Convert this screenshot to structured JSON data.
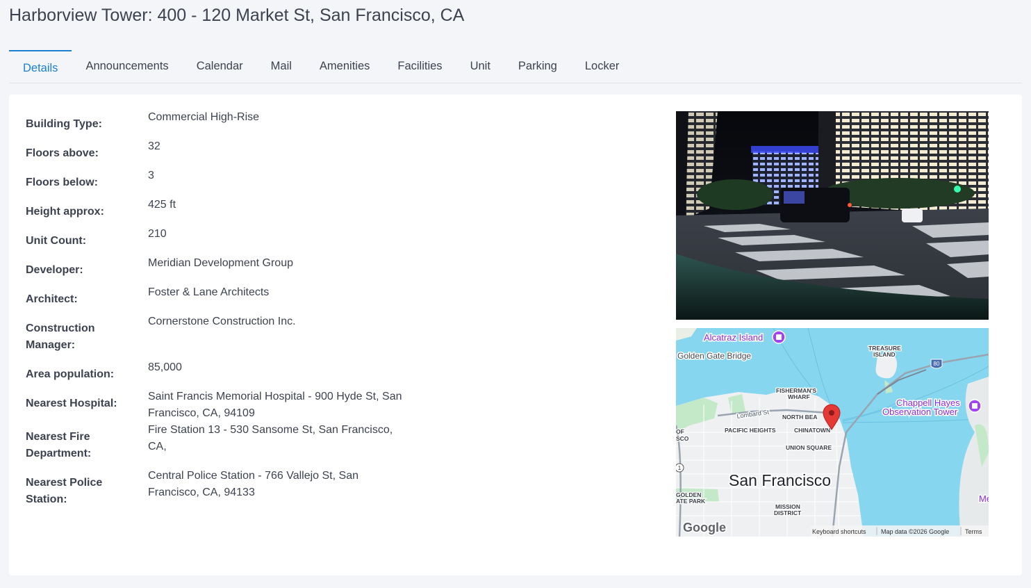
{
  "page": {
    "title": "Harborview Tower: 400 - 120 Market St, San Francisco, CA"
  },
  "tabs": [
    {
      "label": "Details",
      "active": true
    },
    {
      "label": "Announcements"
    },
    {
      "label": "Calendar"
    },
    {
      "label": "Mail"
    },
    {
      "label": "Amenities"
    },
    {
      "label": "Facilities"
    },
    {
      "label": "Unit"
    },
    {
      "label": "Parking"
    },
    {
      "label": "Locker"
    }
  ],
  "details": [
    {
      "label": "Building Type:",
      "value": "Commercial High-Rise"
    },
    {
      "label": "Floors above:",
      "value": "32"
    },
    {
      "label": "Floors below:",
      "value": "3"
    },
    {
      "label": "Height approx:",
      "value": "425 ft"
    },
    {
      "label": "Unit Count:",
      "value": "210"
    },
    {
      "label": "Developer:",
      "value": "Meridian Development Group"
    },
    {
      "label": "Architect:",
      "value": "Foster & Lane Architects"
    },
    {
      "label": "Construction Manager:",
      "value": "Cornerstone Construction Inc."
    },
    {
      "label": "Area population:",
      "value": "85,000"
    },
    {
      "label": "Nearest Hospital:",
      "value": "Saint Francis Memorial Hospital - 900 Hyde St, San Francisco, CA, 94109"
    },
    {
      "label": "Nearest Fire Department:",
      "value": "Fire Station 13 - 530 Sansome St, San Francisco, CA,"
    },
    {
      "label": "Nearest Police Station:",
      "value": "Central Police Station - 766 Vallejo St, San Francisco, CA, 94133"
    }
  ],
  "map": {
    "labels": {
      "alcatraz": "Alcatraz Island",
      "golden_gate": "Golden Gate Bridge",
      "treasure_1": "TREASURE",
      "treasure_2": "ISLAND",
      "fishermans_1": "FISHERMAN'S",
      "fishermans_2": "WHARF",
      "chappell_1": "Chappell Hayes",
      "chappell_2": "Observation Tower",
      "lombard": "Lombard St",
      "north_beach": "NORTH BEA",
      "pacific_heights": "PACIFIC HEIGHTS",
      "chinatown": "CHINATOWN",
      "union_square": "UNION SQUARE",
      "city": "San Francisco",
      "golden_gate_park_1": "GOLDEN",
      "golden_gate_park_2": "ATE PARK",
      "mission_1": "MISSION",
      "mission_2": "DISTRICT",
      "of": "OF",
      "sco": "SCO",
      "me": "Me",
      "route_80": "80",
      "route_1": "1",
      "google": "Google",
      "keyboard": "Keyboard shortcuts",
      "map_data": "Map data ©2026 Google",
      "terms": "Terms"
    }
  },
  "colors": {
    "accent": "#1b7fd1",
    "water": "#7fd3ee",
    "land": "#eef0f2",
    "park": "#c4e9c9",
    "poi": "#a142f4",
    "pin": "#e53935"
  }
}
